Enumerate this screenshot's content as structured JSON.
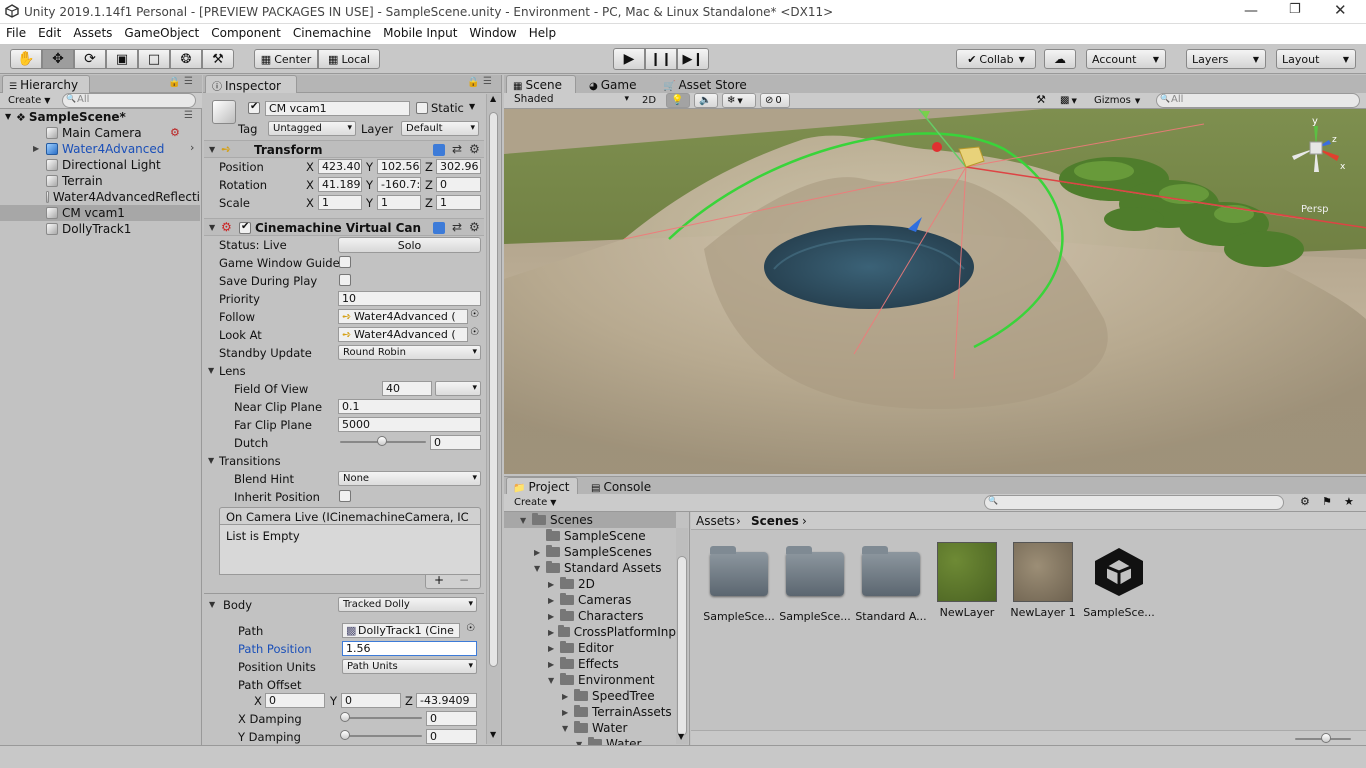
{
  "window": {
    "title": "Unity 2019.1.14f1 Personal - [PREVIEW PACKAGES IN USE] - SampleScene.unity - Environment - PC, Mac & Linux Standalone* <DX11>"
  },
  "menu": [
    "File",
    "Edit",
    "Assets",
    "GameObject",
    "Component",
    "Cinemachine",
    "Mobile Input",
    "Window",
    "Help"
  ],
  "toolbar": {
    "pivot": "Center",
    "space": "Local",
    "collab": "Collab",
    "account": "Account",
    "layers": "Layers",
    "layout": "Layout"
  },
  "hierarchy": {
    "tab": "Hierarchy",
    "create": "Create",
    "search_placeholder": "All",
    "scene": "SampleScene*",
    "items": [
      "Main Camera",
      "Water4Advanced",
      "Directional Light",
      "Terrain",
      "Water4AdvancedReflecti",
      "CM vcam1",
      "DollyTrack1"
    ]
  },
  "inspector": {
    "tab": "Inspector",
    "object_name": "CM vcam1",
    "static_label": "Static",
    "tag_label": "Tag",
    "tag_value": "Untagged",
    "layer_label": "Layer",
    "layer_value": "Default",
    "transform": {
      "header": "Transform",
      "position_label": "Position",
      "rotation_label": "Rotation",
      "scale_label": "Scale",
      "position": [
        "423.40",
        "102.56",
        "302.96"
      ],
      "rotation": [
        "41.189",
        "-160.7:",
        "0"
      ],
      "scale": [
        "1",
        "1",
        "1"
      ],
      "x": "X",
      "y": "Y",
      "z": "Z"
    },
    "vcam": {
      "header": "Cinemachine Virtual Can",
      "status_label": "Status: Live",
      "solo": "Solo",
      "game_window_guides": "Game Window Guide",
      "save_during_play": "Save During Play",
      "priority_label": "Priority",
      "priority": "10",
      "follow_label": "Follow",
      "follow": "Water4Advanced (",
      "lookat_label": "Look At",
      "lookat": "Water4Advanced (",
      "standby_label": "Standby Update",
      "standby": "Round Robin",
      "lens": "Lens",
      "fov_label": "Field Of View",
      "fov": "40",
      "near_label": "Near Clip Plane",
      "near": "0.1",
      "far_label": "Far Clip Plane",
      "far": "5000",
      "dutch_label": "Dutch",
      "dutch": "0",
      "transitions": "Transitions",
      "blend_label": "Blend Hint",
      "blend": "None",
      "inherit_label": "Inherit Position",
      "event_label": "On Camera Live (ICinemachineCamera, IC",
      "list_empty": "List is Empty",
      "plus": "+",
      "minus": "−"
    },
    "body": {
      "label": "Body",
      "value": "Tracked Dolly",
      "path_label": "Path",
      "path": "DollyTrack1 (Cine",
      "path_pos_label": "Path Position",
      "path_pos": "1.56",
      "units_label": "Position Units",
      "units": "Path Units",
      "offset_label": "Path Offset",
      "offset": [
        "0",
        "0",
        "-43.9409"
      ],
      "xdamp_label": "X Damping",
      "xdamp": "0",
      "ydamp_label": "Y Damping",
      "ydamp": "0"
    }
  },
  "scene": {
    "tabs": [
      "Scene",
      "Game",
      "Asset Store"
    ],
    "shading": "Shaded",
    "mode2d": "2D",
    "hidden_count": "0",
    "gizmos": "Gizmos",
    "search_placeholder": "All",
    "persp": "Persp"
  },
  "project": {
    "tabs": [
      "Project",
      "Console"
    ],
    "create": "Create",
    "breadcrumb": [
      "Assets",
      "Scenes"
    ],
    "tree": [
      {
        "label": "Scenes",
        "indent": 0,
        "open": true,
        "selected": true
      },
      {
        "label": "SampleScene",
        "indent": 1,
        "open": null
      },
      {
        "label": "SampleScenes",
        "indent": 1,
        "open": false
      },
      {
        "label": "Standard Assets",
        "indent": 1,
        "open": true
      },
      {
        "label": "2D",
        "indent": 2,
        "open": false
      },
      {
        "label": "Cameras",
        "indent": 2,
        "open": false
      },
      {
        "label": "Characters",
        "indent": 2,
        "open": false
      },
      {
        "label": "CrossPlatformInp",
        "indent": 2,
        "open": false
      },
      {
        "label": "Editor",
        "indent": 2,
        "open": false
      },
      {
        "label": "Effects",
        "indent": 2,
        "open": false
      },
      {
        "label": "Environment",
        "indent": 2,
        "open": true
      },
      {
        "label": "SpeedTree",
        "indent": 3,
        "open": false
      },
      {
        "label": "TerrainAssets",
        "indent": 3,
        "open": false
      },
      {
        "label": "Water",
        "indent": 3,
        "open": true
      },
      {
        "label": "Water",
        "indent": 4,
        "open": true
      }
    ],
    "assets": [
      {
        "label": "SampleSce...",
        "kind": "folder"
      },
      {
        "label": "SampleSce...",
        "kind": "folder"
      },
      {
        "label": "Standard A...",
        "kind": "folder"
      },
      {
        "label": "NewLayer",
        "kind": "grass"
      },
      {
        "label": "NewLayer 1",
        "kind": "gravel"
      },
      {
        "label": "SampleSce...",
        "kind": "unity"
      }
    ]
  },
  "colors": {
    "selection": "#3d7bd8",
    "link_blue": "#1a4fb8",
    "terrain": "#b9ab93",
    "water": "#2f4f62"
  }
}
